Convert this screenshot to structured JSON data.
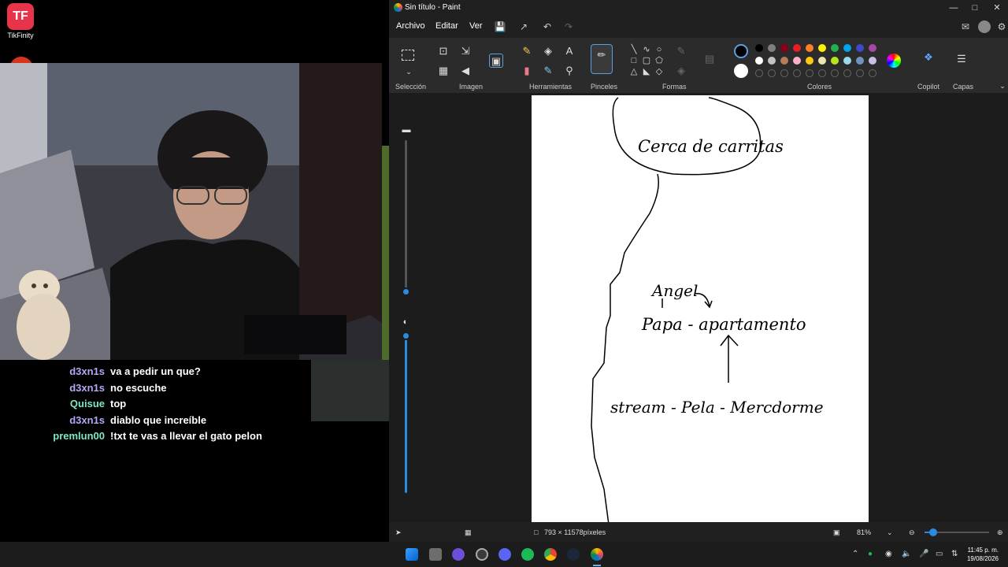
{
  "overlay": {
    "tikfinity_label": "TikFinity",
    "tikfinity_logo": "TF"
  },
  "chat": [
    {
      "user": "d3xn1s",
      "msg": "va a pedir un que?",
      "color": "#b7a6f5"
    },
    {
      "user": "d3xn1s",
      "msg": "no escuche",
      "color": "#b7a6f5"
    },
    {
      "user": "Quisue",
      "msg": "top",
      "color": "#7ee8c4"
    },
    {
      "user": "d3xn1s",
      "msg": "diablo que increíble",
      "color": "#b7a6f5"
    },
    {
      "user": "premlun00",
      "msg": "!txt te vas a llevar el gato pelon",
      "color": "#7ee8c4"
    }
  ],
  "paint": {
    "window_title": "Sin título - Paint",
    "menu": {
      "file": "Archivo",
      "edit": "Editar",
      "view": "Ver"
    },
    "groups": {
      "selection": "Selección",
      "image": "Imagen",
      "tools": "Herramientas",
      "brushes": "Pinceles",
      "shapes": "Formas",
      "colors": "Colores",
      "copilot": "Copilot",
      "layers": "Capas"
    },
    "canvas_text": {
      "bubble": "Cerca de carritas",
      "name": "Angel",
      "line1": "Papa - apartamento",
      "line2": "stream - Pela - Mercdorme"
    },
    "status": {
      "canvas_size": "793 × 11578píxeles",
      "zoom": "81%"
    },
    "palette_row1": [
      "#000000",
      "#7f7f7f",
      "#880015",
      "#ed1c24",
      "#ff7f27",
      "#fff200",
      "#22b14c",
      "#00a2e8",
      "#3f48cc",
      "#a349a4"
    ],
    "palette_row2": [
      "#ffffff",
      "#c3c3c3",
      "#b97a57",
      "#ffaec9",
      "#ffc90e",
      "#efe4b0",
      "#b5e61d",
      "#99d9ea",
      "#7092be",
      "#c8bfe7"
    ]
  },
  "taskbar": {
    "time": "11:45 p. m.",
    "date": "19/08/2026"
  }
}
